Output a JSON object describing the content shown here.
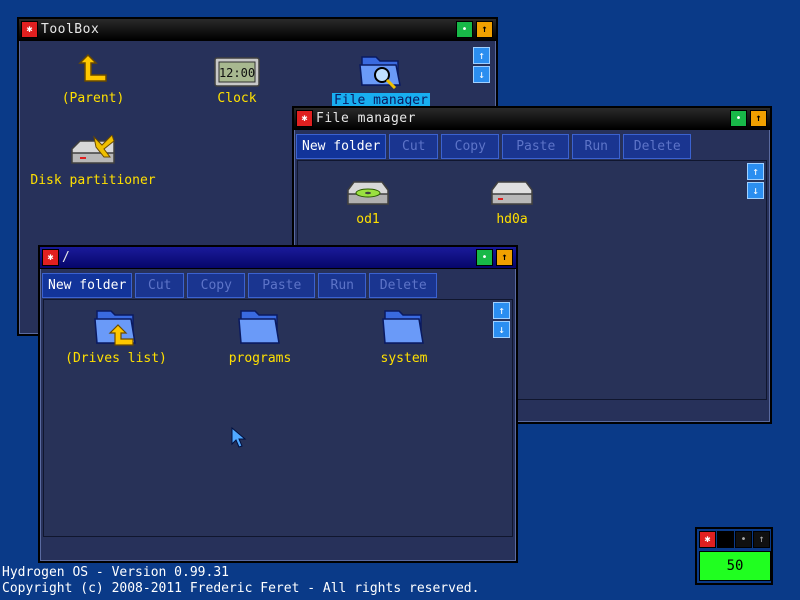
{
  "toolbox": {
    "title": "ToolBox",
    "items": [
      {
        "label": "(Parent)",
        "icon": "parent-arrow-icon"
      },
      {
        "label": "Clock",
        "icon": "clock-icon",
        "clock_text": "12:00"
      },
      {
        "label": "File manager",
        "icon": "file-manager-icon"
      },
      {
        "label": "Disk partitioner",
        "icon": "disk-partitioner-icon"
      }
    ]
  },
  "file_manager": {
    "title": "File manager",
    "toolbar": {
      "new_folder": "New folder",
      "cut": "Cut",
      "copy": "Copy",
      "paste": "Paste",
      "run": "Run",
      "delete": "Delete"
    },
    "items": [
      {
        "label": "od1",
        "icon": "optical-drive-icon"
      },
      {
        "label": "hd0a",
        "icon": "hard-drive-icon"
      }
    ]
  },
  "root_window": {
    "title": "/",
    "toolbar": {
      "new_folder": "New folder",
      "cut": "Cut",
      "copy": "Copy",
      "paste": "Paste",
      "run": "Run",
      "delete": "Delete"
    },
    "items": [
      {
        "label": "(Drives list)",
        "icon": "drives-list-folder-icon"
      },
      {
        "label": "programs",
        "icon": "folder-icon"
      },
      {
        "label": "system",
        "icon": "folder-icon"
      }
    ]
  },
  "footer": {
    "version": "Hydrogen OS - Version 0.99.31",
    "copyright": "Copyright (c) 2008-2011 Frederic Feret - All rights reserved."
  },
  "cpu_meter": {
    "value": "50"
  },
  "colors": {
    "desktop": "#0a3a88",
    "window_bg": "#27315a",
    "label_yellow": "#ffe000",
    "close_red": "#e02020",
    "cpu_green": "#20ff20"
  }
}
